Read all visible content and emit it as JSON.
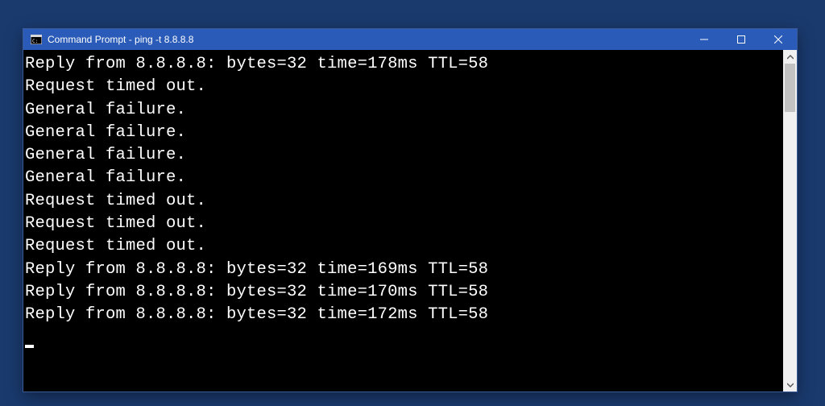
{
  "window": {
    "title": "Command Prompt - ping  -t 8.8.8.8"
  },
  "terminal": {
    "lines": [
      "Reply from 8.8.8.8: bytes=32 time=178ms TTL=58",
      "Request timed out.",
      "General failure.",
      "General failure.",
      "General failure.",
      "General failure.",
      "Request timed out.",
      "Request timed out.",
      "Request timed out.",
      "Reply from 8.8.8.8: bytes=32 time=169ms TTL=58",
      "Reply from 8.8.8.8: bytes=32 time=170ms TTL=58",
      "Reply from 8.8.8.8: bytes=32 time=172ms TTL=58"
    ]
  }
}
